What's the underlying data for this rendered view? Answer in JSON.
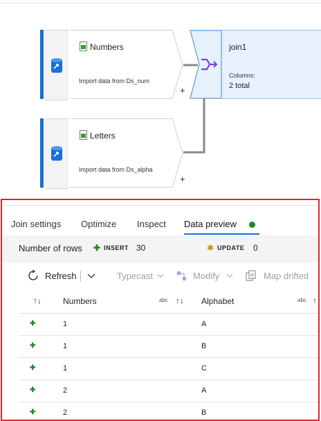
{
  "nodes": [
    {
      "title": "Numbers",
      "subtitle": "Import data from Ds_num"
    },
    {
      "title": "Letters",
      "subtitle": "Import data from Ds_alpha"
    }
  ],
  "join": {
    "title": "join1",
    "columns_label": "Columns:",
    "columns_value": "2 total"
  },
  "plus_sign": "+",
  "tabs": [
    {
      "label": "Join settings"
    },
    {
      "label": "Optimize"
    },
    {
      "label": "Inspect"
    },
    {
      "label": "Data preview",
      "active": true
    }
  ],
  "summary": {
    "rows_label": "Number of rows",
    "insert_label": "INSERT",
    "insert_count": "30",
    "update_label": "UPDATE",
    "update_count": "0"
  },
  "toolbar": {
    "refresh": "Refresh",
    "typecast": "Typecast",
    "modify": "Modify",
    "map_drifted": "Map drifted"
  },
  "grid": {
    "columns": [
      {
        "name": "Numbers",
        "type": "abc"
      },
      {
        "name": "Alphabet",
        "type": "abc"
      }
    ],
    "rows": [
      {
        "num": "1",
        "alpha": "A"
      },
      {
        "num": "1",
        "alpha": "B"
      },
      {
        "num": "1",
        "alpha": "C"
      },
      {
        "num": "2",
        "alpha": "A"
      },
      {
        "num": "2",
        "alpha": "B"
      }
    ]
  },
  "colors": {
    "accent": "#1570d8",
    "status_green": "#1e8a22",
    "panel_border": "#e12525",
    "update_orange": "#d08a00"
  },
  "icons": [
    "database-source-icon",
    "table-file-icon",
    "join-icon",
    "refresh-icon",
    "chevron-down-icon",
    "typecast-icon",
    "modify-icon",
    "map-drifted-icon",
    "sort-icon",
    "insert-plus-icon",
    "update-star-icon"
  ]
}
